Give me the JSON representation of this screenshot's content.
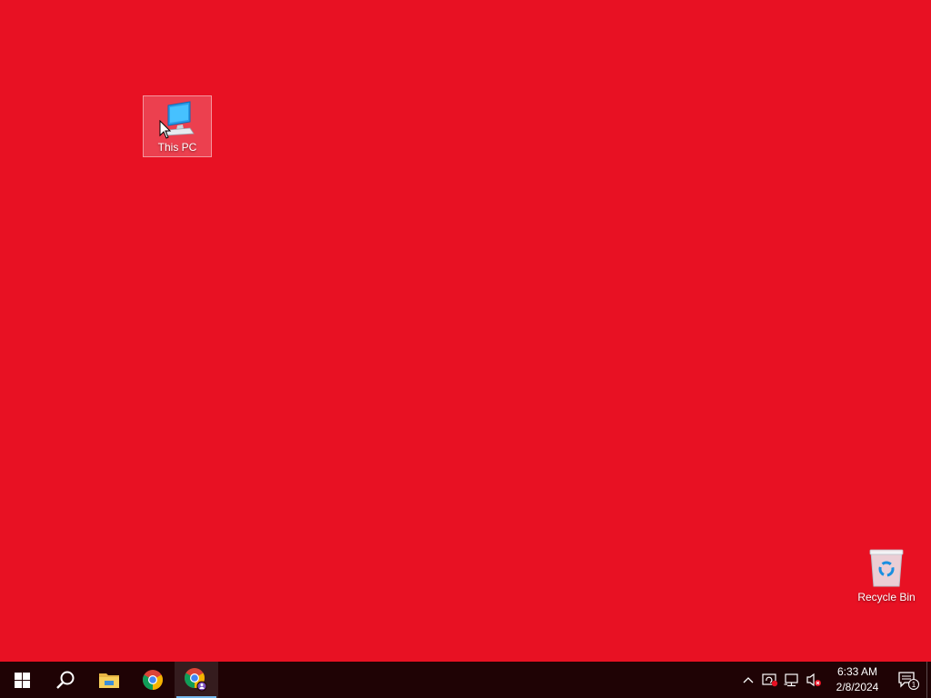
{
  "desktop": {
    "background_color": "#e81123",
    "icons": [
      {
        "label": "This PC",
        "icon": "this-pc-icon",
        "selected": true
      },
      {
        "label": "Recycle Bin",
        "icon": "recycle-bin-icon",
        "selected": false
      }
    ]
  },
  "taskbar": {
    "apps": [
      {
        "name": "Start",
        "icon": "windows-logo-icon"
      },
      {
        "name": "Search",
        "icon": "search-icon"
      },
      {
        "name": "File Explorer",
        "icon": "file-explorer-icon"
      },
      {
        "name": "Google Chrome",
        "icon": "chrome-icon"
      },
      {
        "name": "Google Chrome (profile)",
        "icon": "chrome-profile-icon",
        "active": true
      }
    ],
    "tray": {
      "icons": [
        "chevron-up-icon",
        "security-warning-icon",
        "network-icon",
        "volume-muted-icon"
      ],
      "time": "6:33 AM",
      "date": "2/8/2024",
      "notification_count": "1"
    }
  }
}
